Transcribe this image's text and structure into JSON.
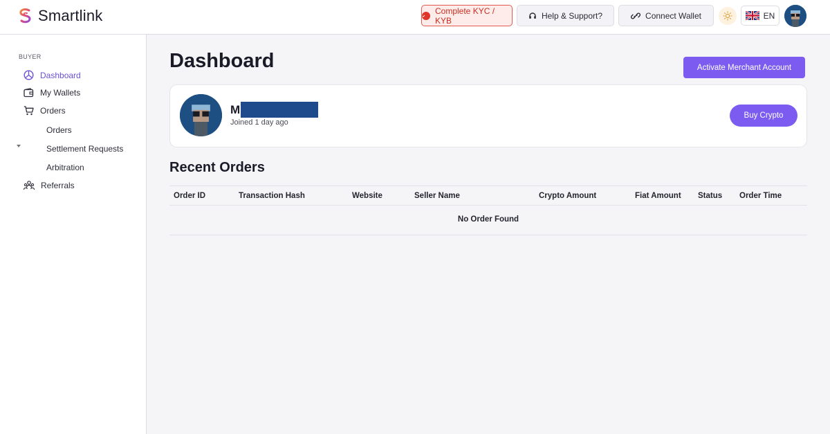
{
  "header": {
    "brand": "Smartlink",
    "kyc_label": "Complete KYC / KYB",
    "help_label": "Help & Support?",
    "connect_label": "Connect Wallet",
    "language": "EN",
    "colors": {
      "accent": "#7c5cf0",
      "warning": "#e0352a"
    },
    "icons": [
      "smartlink-logo-icon",
      "alert-icon",
      "headset-icon",
      "link-icon",
      "sun-icon",
      "uk-flag-icon",
      "avatar-icon"
    ]
  },
  "sidebar": {
    "section_label": "BUYER",
    "items": [
      {
        "label": "Dashboard",
        "icon": "dashboard-icon",
        "active": true
      },
      {
        "label": "My Wallets",
        "icon": "wallet-icon",
        "active": false
      },
      {
        "label": "Orders",
        "icon": "cart-icon",
        "active": false,
        "expanded": true
      },
      {
        "label": "Referrals",
        "icon": "referrals-icon",
        "active": false
      }
    ],
    "orders_sub": [
      "Orders",
      "Settlement Requests",
      "Arbitration"
    ]
  },
  "main": {
    "title": "Dashboard",
    "merchant_button": "Activate Merchant Account",
    "profile": {
      "initial": "M",
      "joined": "Joined 1 day ago",
      "buy_button": "Buy Crypto"
    },
    "recent_orders": {
      "title": "Recent Orders",
      "columns": [
        "Order ID",
        "Transaction Hash",
        "Website",
        "Seller Name",
        "Crypto Amount",
        "Fiat Amount",
        "Status",
        "Order Time"
      ],
      "empty_text": "No Order Found"
    }
  }
}
